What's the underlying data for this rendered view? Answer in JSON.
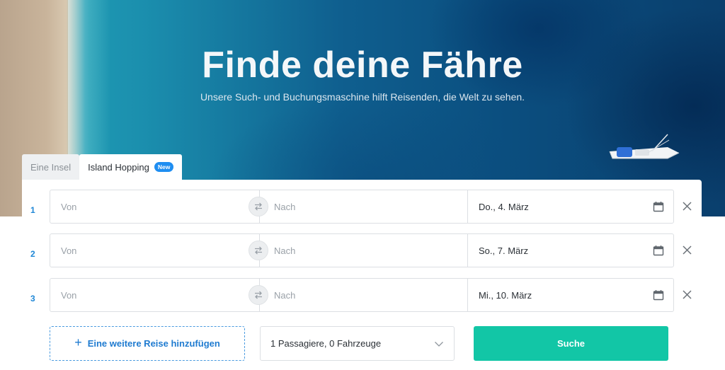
{
  "hero": {
    "title": "Finde deine Fähre",
    "subtitle": "Unsere Such- und Buchungsmaschine hilft Reisenden, die Welt zu sehen."
  },
  "tabs": [
    {
      "label": "Eine Insel",
      "active": false
    },
    {
      "label": "Island Hopping",
      "active": true,
      "badge": "New"
    }
  ],
  "trips": [
    {
      "index": "1",
      "from_placeholder": "Von",
      "to_placeholder": "Nach",
      "date": "Do., 4. März"
    },
    {
      "index": "2",
      "from_placeholder": "Von",
      "to_placeholder": "Nach",
      "date": "So., 7. März"
    },
    {
      "index": "3",
      "from_placeholder": "Von",
      "to_placeholder": "Nach",
      "date": "Mi., 10. März"
    }
  ],
  "actions": {
    "add_trip": "Eine weitere Reise hinzufügen",
    "passengers": "1 Passagiere, 0 Fahrzeuge",
    "search": "Suche"
  },
  "colors": {
    "accent": "#1f8ef1",
    "search_button": "#12c6a6",
    "row_index": "#1f87d6"
  },
  "icons": [
    "swap-icon",
    "calendar-icon",
    "close-icon",
    "plus-icon",
    "chevron-down-icon",
    "boat-icon"
  ]
}
